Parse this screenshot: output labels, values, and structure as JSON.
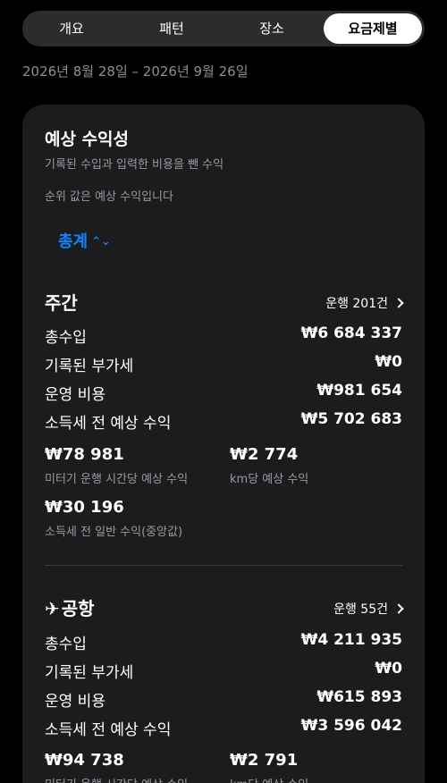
{
  "tabs": [
    {
      "label": "개요"
    },
    {
      "label": "패턴"
    },
    {
      "label": "장소"
    },
    {
      "label": "요금제별"
    }
  ],
  "date_range": "2026년 8월 28일 – 2026년 9월 26일",
  "card": {
    "title": "예상 수익성",
    "subtitle": "기록된 수입과 입력한 비용을 뺀 수익",
    "note": "순위 값은 예상 수익입니다",
    "total_label": "총계",
    "sections": [
      {
        "title": "주간",
        "icon": "",
        "count": "운행 201건",
        "rows": [
          {
            "label": "총수입",
            "value": "₩6 684 337"
          },
          {
            "label": "기록된 부가세",
            "value": "₩0"
          },
          {
            "label": "운영 비용",
            "value": "₩981 654"
          },
          {
            "label": "소득세 전 예상 수익",
            "value": "₩5 702 683"
          }
        ],
        "metrics": [
          {
            "value": "₩78 981",
            "label": "미터기 운행 시간당 예상 수익"
          },
          {
            "value": "₩2 774",
            "label": "km당 예상 수익"
          },
          {
            "value": "₩30 196",
            "label": "소득세 전 일반 수익(중앙값)"
          }
        ]
      },
      {
        "title": "공항",
        "icon": "airplane-icon",
        "count": "운행 55건",
        "rows": [
          {
            "label": "총수입",
            "value": "₩4 211 935"
          },
          {
            "label": "기록된 부가세",
            "value": "₩0"
          },
          {
            "label": "운영 비용",
            "value": "₩615 893"
          },
          {
            "label": "소득세 전 예상 수익",
            "value": "₩3 596 042"
          }
        ],
        "metrics": [
          {
            "value": "₩94 738",
            "label": "미터기 운행 시간당 예상 수익"
          },
          {
            "value": "₩2 791",
            "label": "km당 예상 수익"
          }
        ]
      }
    ]
  },
  "colors": {
    "accent": "#0a84ff",
    "card_bg": "#1c1c1e",
    "segment_bg": "#2c2c2e",
    "muted_text": "#9a9aa0"
  }
}
